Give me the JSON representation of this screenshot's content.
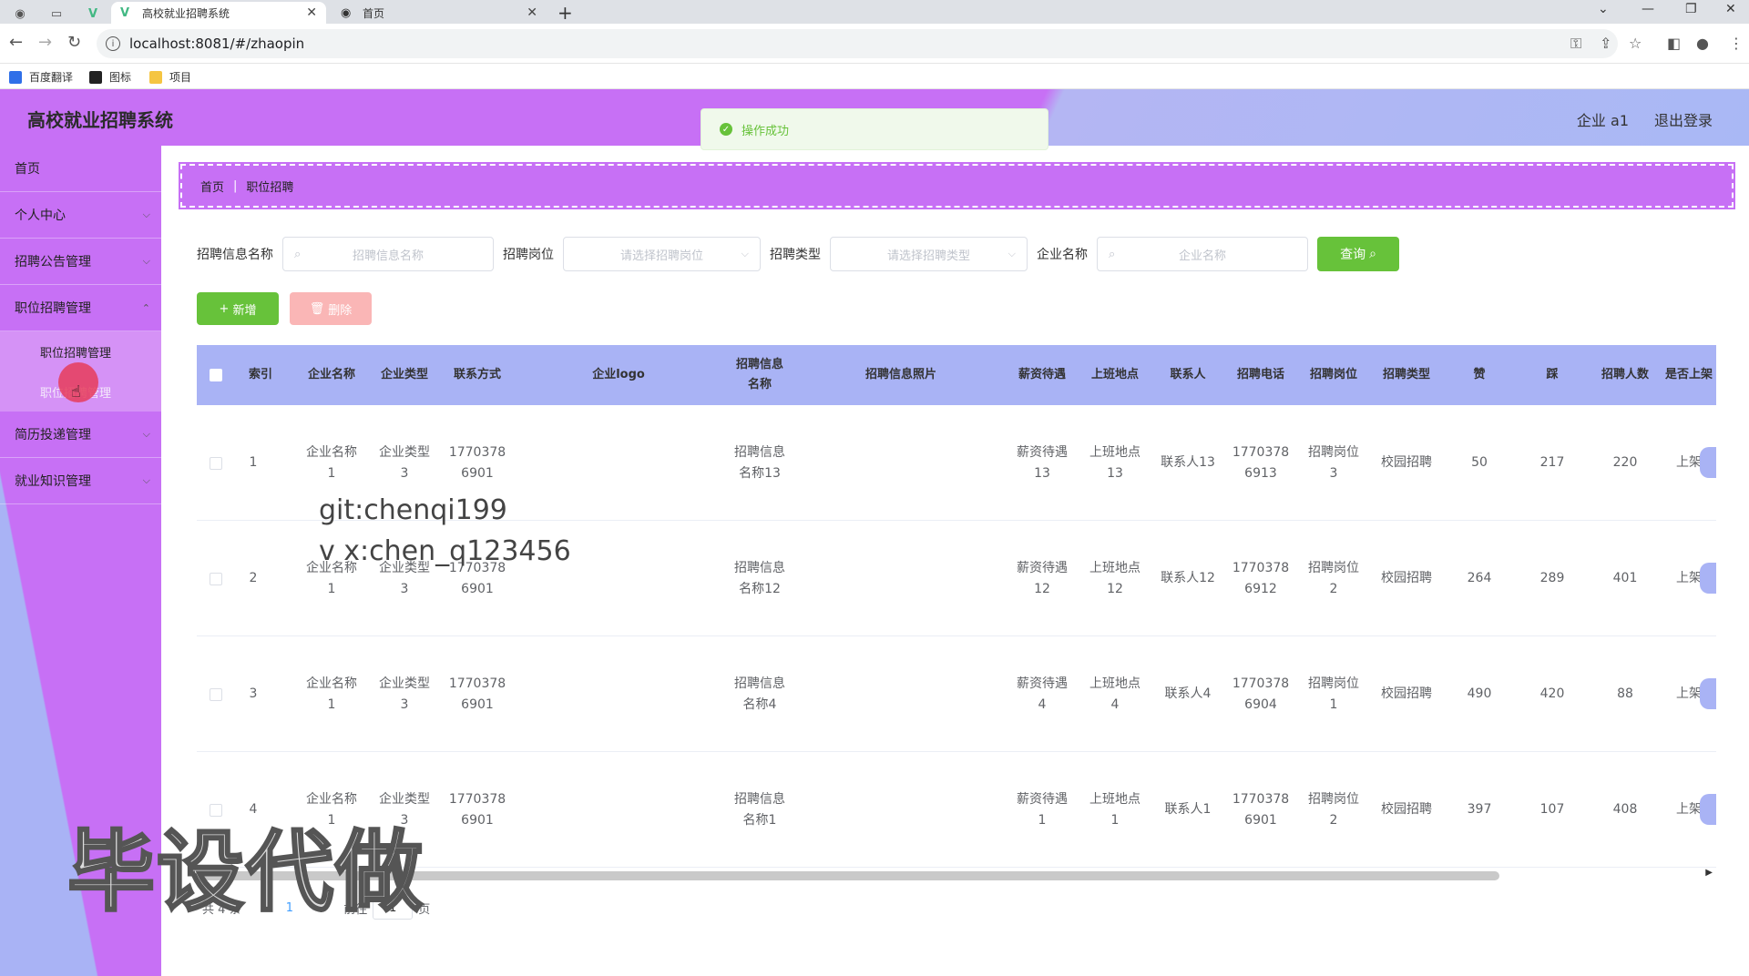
{
  "browser": {
    "tabs": [
      {
        "title": "高校就业招聘系统",
        "icon": "vue-icon"
      },
      {
        "title": "首页",
        "icon": "globe-icon"
      }
    ],
    "url": "localhost:8081/#/zhaopin",
    "bookmarks": [
      "百度翻译",
      "图标",
      "项目"
    ]
  },
  "app": {
    "title": "高校就业招聘系统",
    "user": "企业 a1",
    "logout": "退出登录"
  },
  "toast": "操作成功",
  "sidebar": {
    "items": [
      {
        "label": "首页"
      },
      {
        "label": "个人中心"
      },
      {
        "label": "招聘公告管理"
      },
      {
        "label": "职位招聘管理"
      },
      {
        "label": "简历投递管理"
      },
      {
        "label": "就业知识管理"
      }
    ],
    "subitems": [
      "职位招聘管理",
      "职位招聘管理"
    ]
  },
  "breadcrumb": [
    "首页",
    "职位招聘"
  ],
  "search": {
    "fields": [
      {
        "label": "招聘信息名称",
        "placeholder": "招聘信息名称"
      },
      {
        "label": "招聘岗位",
        "placeholder": "请选择招聘岗位"
      },
      {
        "label": "招聘类型",
        "placeholder": "请选择招聘类型"
      },
      {
        "label": "企业名称",
        "placeholder": "企业名称"
      }
    ],
    "query_btn": "查询"
  },
  "actions": {
    "add": "新增",
    "delete": "删除"
  },
  "table": {
    "headers": [
      "索引",
      "企业名称",
      "企业类型",
      "联系方式",
      "企业logo",
      "招聘信息\n名称",
      "招聘信息照片",
      "薪资待遇",
      "上班地点",
      "联系人",
      "招聘电话",
      "招聘岗位",
      "招聘类型",
      "赞",
      "踩",
      "招聘人数",
      "是否上架"
    ],
    "rows": [
      {
        "index": "1",
        "company": "企业名称\n1",
        "ctype": "企业类型\n3",
        "contact": "1770378\n6901",
        "info": "招聘信息\n名称13",
        "salary": "薪资待遇\n13",
        "location": "上班地点\n13",
        "person": "联系人13",
        "phone": "1770378\n6913",
        "post": "招聘岗位\n3",
        "rtype": "校园招聘",
        "like": "50",
        "dislike": "217",
        "count": "220",
        "listed": "上架"
      },
      {
        "index": "2",
        "company": "企业名称\n1",
        "ctype": "企业类型\n3",
        "contact": "1770378\n6901",
        "info": "招聘信息\n名称12",
        "salary": "薪资待遇\n12",
        "location": "上班地点\n12",
        "person": "联系人12",
        "phone": "1770378\n6912",
        "post": "招聘岗位\n2",
        "rtype": "校园招聘",
        "like": "264",
        "dislike": "289",
        "count": "401",
        "listed": "上架"
      },
      {
        "index": "3",
        "company": "企业名称\n1",
        "ctype": "企业类型\n3",
        "contact": "1770378\n6901",
        "info": "招聘信息\n名称4",
        "salary": "薪资待遇\n4",
        "location": "上班地点\n4",
        "person": "联系人4",
        "phone": "1770378\n6904",
        "post": "招聘岗位\n1",
        "rtype": "校园招聘",
        "like": "490",
        "dislike": "420",
        "count": "88",
        "listed": "上架"
      },
      {
        "index": "4",
        "company": "企业名称\n1",
        "ctype": "企业类型\n3",
        "contact": "1770378\n6901",
        "info": "招聘信息\n名称1",
        "salary": "薪资待遇\n1",
        "location": "上班地点\n1",
        "person": "联系人1",
        "phone": "1770378\n6901",
        "post": "招聘岗位\n2",
        "rtype": "校园招聘",
        "like": "397",
        "dislike": "107",
        "count": "408",
        "listed": "上架"
      }
    ]
  },
  "pagination": {
    "total": "共 4 条",
    "current": "1",
    "goto": "前往",
    "page_unit": "页"
  },
  "watermarks": [
    "git:chenqi199",
    "v x:chen_q123456",
    "毕设代做"
  ]
}
